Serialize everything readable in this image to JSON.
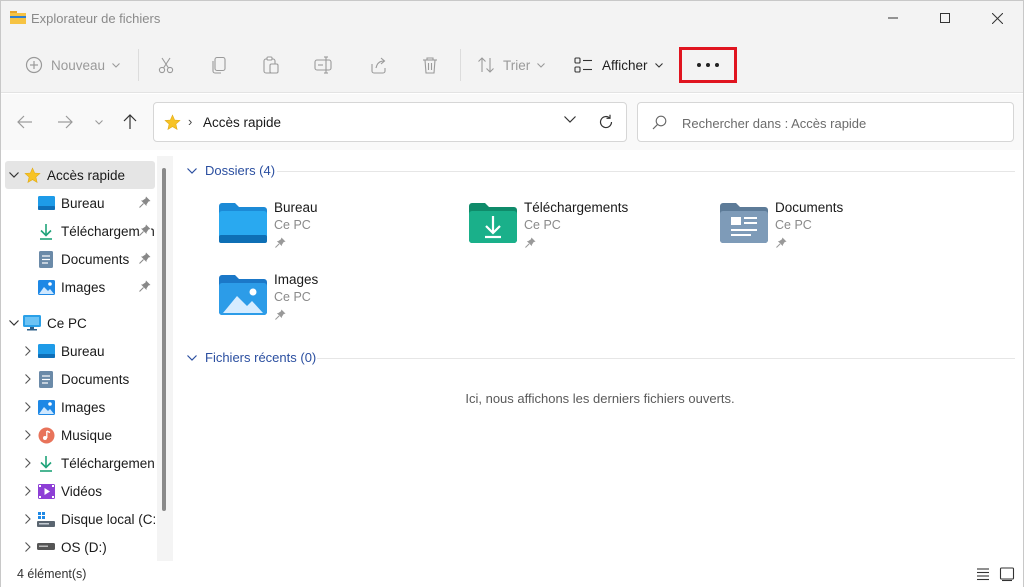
{
  "window": {
    "title": "Explorateur de fichiers"
  },
  "toolbar": {
    "new_label": "Nouveau",
    "sort_label": "Trier",
    "view_label": "Afficher",
    "more_label": "..."
  },
  "nav": {
    "address_crumb": "Accès rapide",
    "search_placeholder": "Rechercher dans : Accès rapide"
  },
  "sidebar": {
    "quick_access": {
      "label": "Accès rapide",
      "items": [
        {
          "label": "Bureau",
          "icon": "desktop-icon"
        },
        {
          "label": "Téléchargements",
          "icon": "download-icon"
        },
        {
          "label": "Documents",
          "icon": "documents-icon"
        },
        {
          "label": "Images",
          "icon": "pictures-icon"
        }
      ]
    },
    "this_pc": {
      "label": "Ce PC",
      "items": [
        {
          "label": "Bureau",
          "icon": "desktop-icon"
        },
        {
          "label": "Documents",
          "icon": "documents-icon"
        },
        {
          "label": "Images",
          "icon": "pictures-icon"
        },
        {
          "label": "Musique",
          "icon": "music-icon"
        },
        {
          "label": "Téléchargements",
          "icon": "download-icon"
        },
        {
          "label": "Vidéos",
          "icon": "videos-icon"
        },
        {
          "label": "Disque local (C:)",
          "icon": "drive-c-icon"
        },
        {
          "label": "OS (D:)",
          "icon": "drive-d-icon"
        }
      ]
    }
  },
  "content": {
    "folders_header": "Dossiers (4)",
    "folders": [
      {
        "name": "Bureau",
        "location": "Ce PC",
        "icon": "desktop-folder-icon"
      },
      {
        "name": "Téléchargements",
        "location": "Ce PC",
        "icon": "downloads-folder-icon"
      },
      {
        "name": "Documents",
        "location": "Ce PC",
        "icon": "documents-folder-icon"
      },
      {
        "name": "Images",
        "location": "Ce PC",
        "icon": "pictures-folder-icon"
      }
    ],
    "recent_header": "Fichiers récents (0)",
    "recent_empty": "Ici, nous affichons les derniers fichiers ouverts."
  },
  "status": {
    "count": "4 élément(s)"
  },
  "colors": {
    "highlight_box": "#e0141f",
    "group_header": "#2b4fa0",
    "selected_bg": "#e5e5e5"
  }
}
